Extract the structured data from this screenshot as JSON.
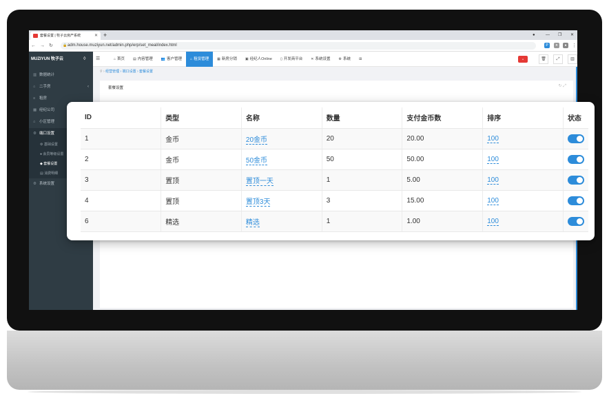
{
  "browser": {
    "tab_title": "套餐设置 | 牧子云房产系统",
    "url": "adm.house.muziyun.net/admin.php/erp/set_meal/index.html"
  },
  "app": {
    "logo": "MUZIYUN 牧子云",
    "logo_sub": "MUZIYUN·HOUSE",
    "topnav": [
      {
        "icon": "home-icon",
        "label": "首页"
      },
      {
        "icon": "document-icon",
        "label": "内容管理"
      },
      {
        "icon": "users-icon",
        "label": "客户管理"
      },
      {
        "icon": "home-icon",
        "label": "租赁管理"
      },
      {
        "icon": "building-icon",
        "label": "新房分销"
      },
      {
        "icon": "id-card-icon",
        "label": "经纪人Online"
      },
      {
        "icon": "file-icon",
        "label": "开发商平台"
      },
      {
        "icon": "wrench-icon",
        "label": "系统设置"
      },
      {
        "icon": "gear-icon",
        "label": "系统"
      }
    ],
    "sidebar": [
      {
        "label": "数据统计"
      },
      {
        "label": "二手房"
      },
      {
        "label": "租房"
      },
      {
        "label": "经纪公司"
      },
      {
        "label": "小区管理"
      },
      {
        "label": "端口设置"
      },
      {
        "label": "系统设置"
      }
    ],
    "sidebar_sub": [
      {
        "label": "基础设置"
      },
      {
        "label": "会员等级设置"
      },
      {
        "label": "套餐设置"
      },
      {
        "label": "消费明细"
      }
    ],
    "breadcrumb": [
      "经营管理",
      "端口设置",
      "套餐设置"
    ],
    "panel_title": "套餐设置"
  },
  "table": {
    "headers": [
      "ID",
      "类型",
      "名称",
      "数量",
      "支付金币数",
      "排序",
      "状态"
    ],
    "rows": [
      {
        "id": "1",
        "type": "金币",
        "name": "20金币",
        "qty": "20",
        "amount": "20.00",
        "sort": "100"
      },
      {
        "id": "2",
        "type": "金币",
        "name": "50金币",
        "qty": "50",
        "amount": "50.00",
        "sort": "100"
      },
      {
        "id": "3",
        "type": "置顶",
        "name": "置顶一天",
        "qty": "1",
        "amount": "5.00",
        "sort": "100"
      },
      {
        "id": "4",
        "type": "置顶",
        "name": "置顶3天",
        "qty": "3",
        "amount": "15.00",
        "sort": "100"
      },
      {
        "id": "6",
        "type": "精选",
        "name": "精选",
        "qty": "1",
        "amount": "1.00",
        "sort": "100"
      }
    ]
  },
  "colors": {
    "accent": "#2d8cda",
    "sidebar": "#2f3c44"
  }
}
